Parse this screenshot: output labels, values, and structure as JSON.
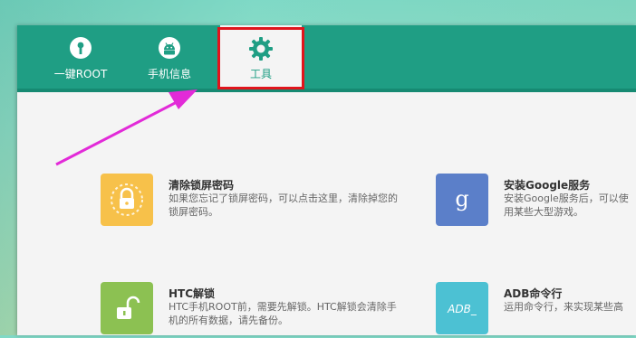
{
  "tabs": [
    {
      "label": "一键ROOT",
      "icon": "key-icon"
    },
    {
      "label": "手机信息",
      "icon": "android-icon"
    },
    {
      "label": "工具",
      "icon": "gear-icon",
      "active": true
    }
  ],
  "tools": [
    {
      "title": "清除锁屏密码",
      "desc": "如果您忘记了锁屏密码，可以点击这里，清除掉您的锁屏密码。",
      "icon": "lock-screen-icon",
      "color": "#f7c14a"
    },
    {
      "title": "安装Google服务",
      "desc": "安装Google服务后，可以使用某些大型游戏。",
      "icon": "google-g-icon",
      "color": "#5b7fc9"
    },
    {
      "title": "HTC解锁",
      "desc": "HTC手机ROOT前，需要先解锁。HTC解锁会清除手机的所有数据，请先备份。",
      "icon": "unlock-icon",
      "color": "#8cc152"
    },
    {
      "title": "ADB命令行",
      "desc": "运用命令行，来实现某些高",
      "icon": "adb-icon",
      "icon_text": "ADB_",
      "color": "#4cc1d3"
    }
  ],
  "colors": {
    "header": "#1f9e84",
    "highlight": "#e0141c",
    "arrow": "#e22ad8"
  }
}
